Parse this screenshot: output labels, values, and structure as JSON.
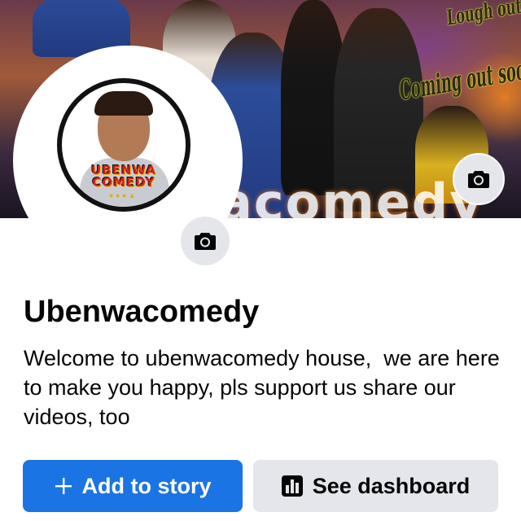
{
  "cover": {
    "overlay_text_top": "Lough out",
    "overlay_text_middle": "Coming out soon",
    "watermark": "acomedy",
    "camera_icon": "camera-icon"
  },
  "profile": {
    "logo_text_line1": "UBENWA",
    "logo_text_line2": "COMEDY",
    "camera_icon": "camera-icon"
  },
  "page": {
    "name": "Ubenwacomedy",
    "bio": "Welcome to ubenwacomedy house,  we are here to make you happy, pls support us share our videos, too"
  },
  "actions": {
    "add_to_story": {
      "label": "Add to story",
      "icon": "plus-icon",
      "color": "#1b74e4"
    },
    "see_dashboard": {
      "label": "See dashboard",
      "icon": "bar-chart-icon",
      "color": "#e4e6eb"
    }
  }
}
